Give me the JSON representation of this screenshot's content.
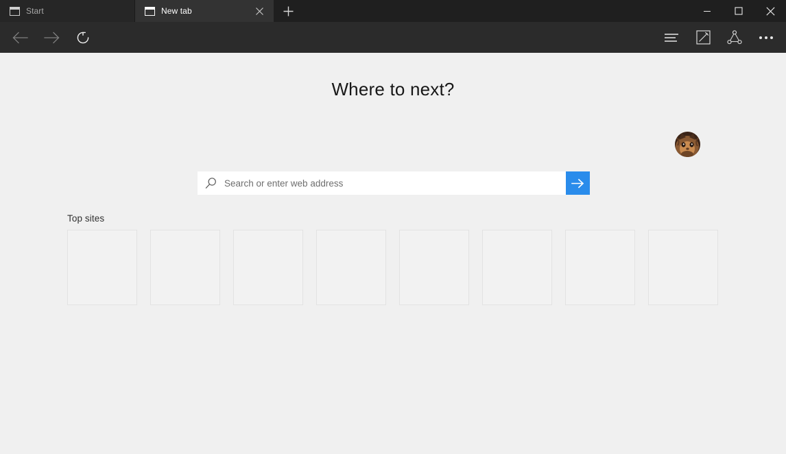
{
  "window": {
    "controls": [
      {
        "name": "minimize",
        "label": "Minimize",
        "glyph": "minimize-icon"
      },
      {
        "name": "maximize",
        "label": "Maximize",
        "glyph": "maximize-icon"
      },
      {
        "name": "close",
        "label": "Close",
        "glyph": "close-icon"
      }
    ]
  },
  "tabs": {
    "items": [
      {
        "title": "Start",
        "active": false,
        "favicon": "window-icon",
        "has_close": false
      },
      {
        "title": "New tab",
        "active": true,
        "favicon": "window-icon",
        "has_close": true
      }
    ],
    "new_tab_label": "+",
    "new_tab_tooltip": "New tab"
  },
  "toolbar": {
    "back_label": "Back",
    "forward_label": "Forward",
    "refresh_label": "Refresh",
    "reading_view_label": "Reading view",
    "web_note_label": "Make a Web Note",
    "share_label": "Share",
    "more_label": "More"
  },
  "content": {
    "heading": "Where to next?",
    "search": {
      "placeholder": "Search or enter web address",
      "value": "",
      "go_label": "Go",
      "icon": "search-icon"
    },
    "top_sites": {
      "label": "Top sites",
      "tiles": [
        {
          "title": "",
          "empty": true
        },
        {
          "title": "",
          "empty": true
        },
        {
          "title": "",
          "empty": true
        },
        {
          "title": "",
          "empty": true
        },
        {
          "title": "",
          "empty": true
        },
        {
          "title": "",
          "empty": true
        },
        {
          "title": "",
          "empty": true
        },
        {
          "title": "",
          "empty": true
        }
      ]
    },
    "profile": {
      "label": "Profile",
      "image": "cat-avatar"
    }
  },
  "colors": {
    "tabstrip_bg": "#1f1f1f",
    "tab_inactive_bg": "#262626",
    "tab_active_bg": "#333333",
    "toolbar_bg": "#2b2b2b",
    "page_bg": "#f0f0f0",
    "accent_blue": "#2a8ceb",
    "tile_bg": "#f2f2f2",
    "tile_border": "#e2e2e2"
  }
}
